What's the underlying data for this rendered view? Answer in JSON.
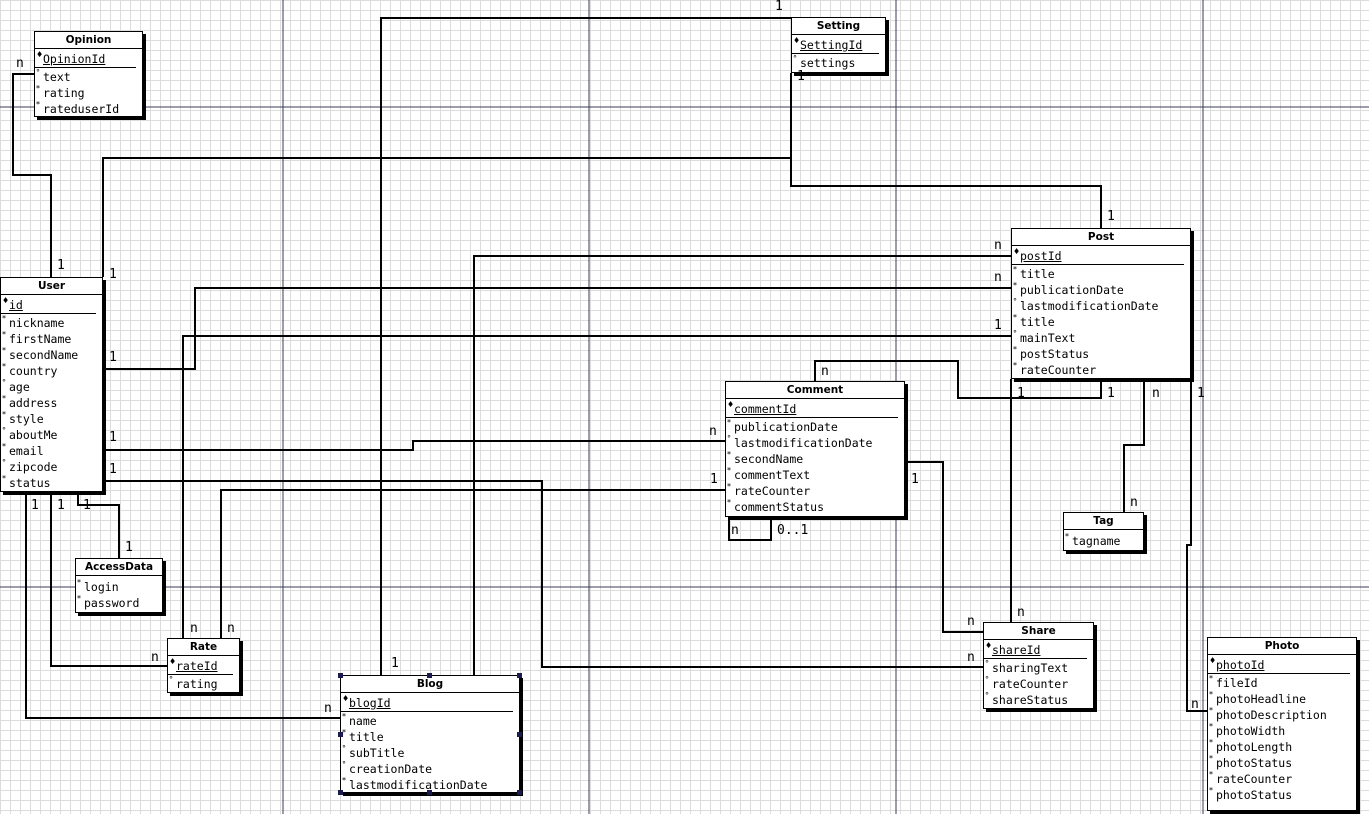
{
  "entities": [
    {
      "id": "opinion",
      "name": "Opinion",
      "attrs": [
        {
          "name": "OpinionId",
          "pk": true,
          "mark": "♦"
        },
        {
          "name": "text",
          "mark": "°"
        },
        {
          "name": "rating",
          "mark": "*"
        },
        {
          "name": "rateduserId",
          "mark": "*"
        }
      ]
    },
    {
      "id": "setting",
      "name": "Setting",
      "attrs": [
        {
          "name": "SettingId",
          "pk": true,
          "mark": "♦"
        },
        {
          "name": "settings",
          "mark": "°"
        }
      ]
    },
    {
      "id": "user",
      "name": "User",
      "attrs": [
        {
          "name": "id",
          "pk": true,
          "mark": "♦"
        },
        {
          "name": "nickname",
          "mark": "*"
        },
        {
          "name": "firstName",
          "mark": "*"
        },
        {
          "name": "secondName",
          "mark": "*"
        },
        {
          "name": "country",
          "mark": "*"
        },
        {
          "name": "age",
          "mark": "°"
        },
        {
          "name": "address",
          "mark": "*"
        },
        {
          "name": "style",
          "mark": "*"
        },
        {
          "name": "aboutMe",
          "mark": "°"
        },
        {
          "name": "email",
          "mark": "*"
        },
        {
          "name": "zipcode",
          "mark": "°"
        },
        {
          "name": "status",
          "mark": "*"
        }
      ]
    },
    {
      "id": "post",
      "name": "Post",
      "attrs": [
        {
          "name": "postId",
          "pk": true,
          "mark": "♦"
        },
        {
          "name": "title",
          "mark": "*"
        },
        {
          "name": "publicationDate",
          "mark": "*"
        },
        {
          "name": "lastmodificationDate",
          "mark": "°"
        },
        {
          "name": "title",
          "mark": "*"
        },
        {
          "name": "mainText",
          "mark": "°"
        },
        {
          "name": "postStatus",
          "mark": "*"
        },
        {
          "name": "rateCounter",
          "mark": "*"
        }
      ]
    },
    {
      "id": "comment",
      "name": "Comment",
      "attrs": [
        {
          "name": "commentId",
          "pk": true,
          "mark": "♦"
        },
        {
          "name": "publicationDate",
          "mark": "*"
        },
        {
          "name": "lastmodificationDate",
          "mark": "°"
        },
        {
          "name": "secondName",
          "mark": "*"
        },
        {
          "name": "commentText",
          "mark": "*"
        },
        {
          "name": "rateCounter",
          "mark": "*"
        },
        {
          "name": "commentStatus",
          "mark": "*"
        }
      ]
    },
    {
      "id": "tag",
      "name": "Tag",
      "attrs": [
        {
          "name": "tagname",
          "mark": "*"
        }
      ]
    },
    {
      "id": "accessdata",
      "name": "AccessData",
      "attrs": [
        {
          "name": "login",
          "mark": "*"
        },
        {
          "name": "password",
          "mark": "*"
        }
      ]
    },
    {
      "id": "rate",
      "name": "Rate",
      "attrs": [
        {
          "name": "rateId",
          "pk": true,
          "mark": "♦"
        },
        {
          "name": "rating",
          "mark": "°"
        }
      ]
    },
    {
      "id": "blog",
      "name": "Blog",
      "attrs": [
        {
          "name": "blogId",
          "pk": true,
          "mark": "♦"
        },
        {
          "name": "name",
          "mark": "*"
        },
        {
          "name": "title",
          "mark": "*"
        },
        {
          "name": "subTitle",
          "mark": "°"
        },
        {
          "name": "creationDate",
          "mark": "°"
        },
        {
          "name": "lastmodificationDate",
          "mark": "*"
        }
      ]
    },
    {
      "id": "share",
      "name": "Share",
      "attrs": [
        {
          "name": "shareId",
          "pk": true,
          "mark": "♦"
        },
        {
          "name": "sharingText",
          "mark": "°"
        },
        {
          "name": "rateCounter",
          "mark": "°"
        },
        {
          "name": "shareStatus",
          "mark": "°"
        }
      ]
    },
    {
      "id": "photo",
      "name": "Photo",
      "attrs": [
        {
          "name": "photoId",
          "pk": true,
          "mark": "♦"
        },
        {
          "name": "fileId",
          "mark": "*"
        },
        {
          "name": "photoHeadline",
          "mark": "*"
        },
        {
          "name": "photoDescription",
          "mark": "*"
        },
        {
          "name": "photoWidth",
          "mark": "*"
        },
        {
          "name": "photoLength",
          "mark": "*"
        },
        {
          "name": "photoStatus",
          "mark": "*"
        },
        {
          "name": "rateCounter",
          "mark": "*"
        },
        {
          "name": "photoStatus",
          "mark": "*"
        }
      ]
    }
  ],
  "cardinalities": [
    "1",
    "n",
    "1",
    "1",
    "1",
    "n",
    "n",
    "1",
    "1",
    "1",
    "1",
    "1",
    "1",
    "n",
    "1",
    "1",
    "1",
    "1",
    "n",
    "n",
    "n",
    "n",
    "n",
    "1",
    "1",
    "1",
    "1",
    "n",
    "n",
    "n",
    "0..1",
    "n",
    "n",
    "1",
    "n",
    "n"
  ]
}
